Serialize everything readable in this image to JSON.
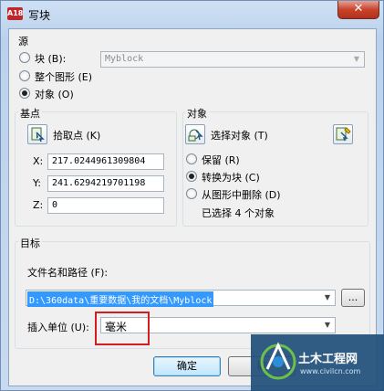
{
  "window": {
    "title": "写块",
    "app_icon_text": "A18",
    "close_symbol": "✕"
  },
  "source": {
    "heading": "源",
    "block_label": "块 (B):",
    "block_combo_value": "Myblock",
    "whole_drawing_label": "整个图形 (E)",
    "objects_label": "对象 (O)",
    "selected": "objects"
  },
  "base_point": {
    "heading": "基点",
    "pick_label": "拾取点 (K)",
    "x_label": "X:",
    "x_value": "217.0244961309804",
    "y_label": "Y:",
    "y_value": "241.6294219701198",
    "z_label": "Z:",
    "z_value": "0"
  },
  "objects": {
    "heading": "对象",
    "select_label": "选择对象 (T)",
    "retain_label": "保留 (R)",
    "convert_label": "转换为块 (C)",
    "delete_label": "从图形中删除 (D)",
    "selected_option": "convert",
    "status": "已选择 4 个对象"
  },
  "destination": {
    "heading": "目标",
    "path_label": "文件名和路径 (F):",
    "path_value": "D:\\360data\\重要数据\\我的文档\\Myblock",
    "browse_label": "...",
    "units_label": "插入单位 (U):",
    "units_value": "毫米"
  },
  "buttons": {
    "ok": "确定",
    "cancel": "取"
  },
  "watermark": {
    "name": "土木工程网",
    "url": "www.civilcn.com"
  },
  "colors": {
    "selection": "#3399ff",
    "highlight": "#d21e1e",
    "close": "#c7432c"
  }
}
